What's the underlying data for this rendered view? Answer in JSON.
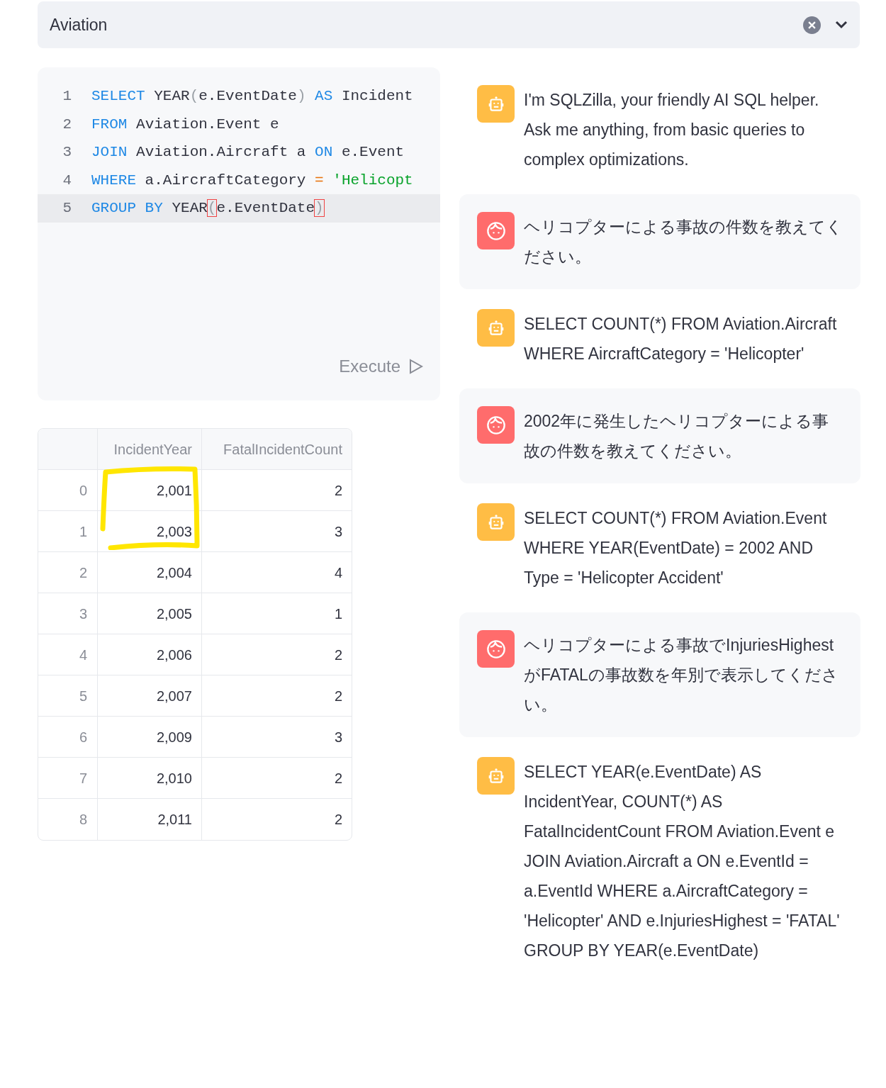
{
  "select": {
    "value": "Aviation"
  },
  "editor": {
    "lines": [
      {
        "number": "1",
        "active": false,
        "tokens": [
          {
            "kind": "keyword",
            "text": "SELECT"
          },
          {
            "kind": "text",
            "text": " YEAR"
          },
          {
            "kind": "punct",
            "text": "("
          },
          {
            "kind": "text",
            "text": "e.EventDate"
          },
          {
            "kind": "punct",
            "text": ")"
          },
          {
            "kind": "keyword",
            "text": " AS"
          },
          {
            "kind": "text",
            "text": " Incident"
          }
        ]
      },
      {
        "number": "2",
        "active": false,
        "tokens": [
          {
            "kind": "keyword",
            "text": "FROM"
          },
          {
            "kind": "text",
            "text": " Aviation.Event e"
          }
        ]
      },
      {
        "number": "3",
        "active": false,
        "tokens": [
          {
            "kind": "keyword",
            "text": "JOIN"
          },
          {
            "kind": "text",
            "text": " Aviation.Aircraft a "
          },
          {
            "kind": "keyword",
            "text": "ON"
          },
          {
            "kind": "text",
            "text": " e.Event"
          }
        ]
      },
      {
        "number": "4",
        "active": false,
        "tokens": [
          {
            "kind": "keyword",
            "text": "WHERE"
          },
          {
            "kind": "text",
            "text": " a.AircraftCategory "
          },
          {
            "kind": "operator",
            "text": "="
          },
          {
            "kind": "string",
            "text": " 'Helicopt"
          }
        ]
      },
      {
        "number": "5",
        "active": true,
        "tokens": [
          {
            "kind": "keyword",
            "text": "GROUP"
          },
          {
            "kind": "keyword",
            "text": " BY"
          },
          {
            "kind": "text",
            "text": " YEAR"
          },
          {
            "kind": "match",
            "text": "("
          },
          {
            "kind": "text",
            "text": "e.EventDate"
          },
          {
            "kind": "match",
            "text": ")"
          }
        ]
      }
    ],
    "execute_label": "Execute"
  },
  "table": {
    "columns": [
      "IncidentYear",
      "FatalIncidentCount"
    ],
    "rows": [
      {
        "index": "0",
        "cells": [
          "2,001",
          "2"
        ]
      },
      {
        "index": "1",
        "cells": [
          "2,003",
          "3"
        ]
      },
      {
        "index": "2",
        "cells": [
          "2,004",
          "4"
        ]
      },
      {
        "index": "3",
        "cells": [
          "2,005",
          "1"
        ]
      },
      {
        "index": "4",
        "cells": [
          "2,006",
          "2"
        ]
      },
      {
        "index": "5",
        "cells": [
          "2,007",
          "2"
        ]
      },
      {
        "index": "6",
        "cells": [
          "2,009",
          "3"
        ]
      },
      {
        "index": "7",
        "cells": [
          "2,010",
          "2"
        ]
      },
      {
        "index": "8",
        "cells": [
          "2,011",
          "2"
        ]
      }
    ]
  },
  "messages": [
    {
      "kind": "assistant",
      "text": "I'm SQLZilla, your friendly AI SQL helper. Ask me anything, from basic queries to complex optimizations."
    },
    {
      "kind": "user",
      "text": "ヘリコプターによる事故の件数を教えてください。"
    },
    {
      "kind": "assistant",
      "text": "SELECT COUNT(*) FROM Aviation.Aircraft WHERE AircraftCategory = 'Helicopter'"
    },
    {
      "kind": "user",
      "text": "2002年に発生したヘリコプターによる事故の件数を教えてください。"
    },
    {
      "kind": "assistant",
      "text": "SELECT COUNT(*) FROM Aviation.Event WHERE YEAR(EventDate) = 2002 AND Type = 'Helicopter Accident'"
    },
    {
      "kind": "user",
      "text": "ヘリコプターによる事故でInjuriesHighestがFATALの事故数を年別で表示してください。"
    },
    {
      "kind": "assistant",
      "text": "SELECT YEAR(e.EventDate) AS IncidentYear, COUNT(*) AS FatalIncidentCount FROM Aviation.Event e JOIN Aviation.Aircraft a ON e.EventId = a.EventId WHERE a.AircraftCategory = 'Helicopter' AND e.InjuriesHighest = 'FATAL' GROUP BY YEAR(e.EventDate)"
    }
  ]
}
